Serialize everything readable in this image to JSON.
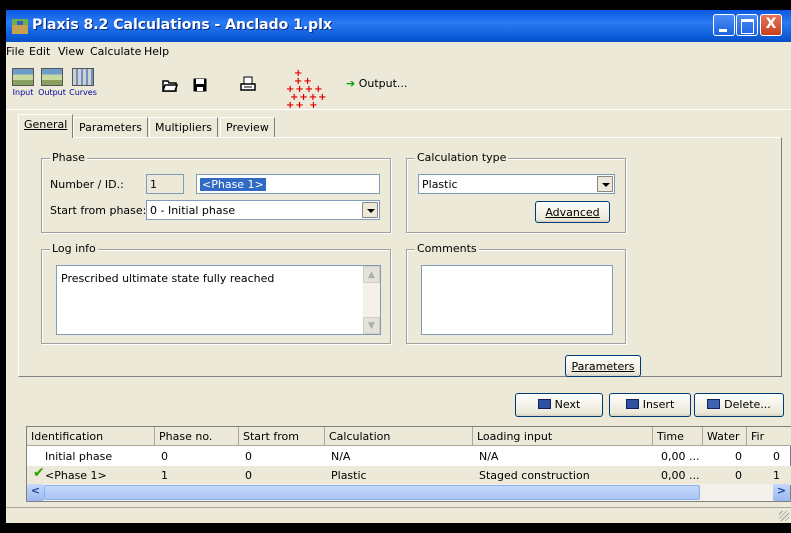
{
  "window": {
    "title": "Plaxis 8.2 Calculations - Anclado 1.plx",
    "controls": [
      "minimize",
      "maximize",
      "close"
    ],
    "close_glyph": "X"
  },
  "menu": {
    "items": [
      "File",
      "Edit",
      "View",
      "Calculate",
      "Help"
    ]
  },
  "toolbar": {
    "input_label": "Input",
    "output_label": "Output",
    "curves_label": "Curves",
    "open_icon": "folder-open-icon",
    "save_icon": "floppy-disk-icon",
    "print_icon": "printer-icon",
    "select_points_icon": "red-plus-grid-icon",
    "output_button_label": "Output..."
  },
  "tabs": [
    {
      "label": "General",
      "active": true
    },
    {
      "label": "Parameters",
      "active": false
    },
    {
      "label": "Multipliers",
      "active": false
    },
    {
      "label": "Preview",
      "active": false
    }
  ],
  "phase": {
    "group_title": "Phase",
    "number_label": "Number / ID.:",
    "number_value": "1",
    "id_value": "<Phase 1>",
    "start_label": "Start from phase:",
    "start_value": "0 - Initial phase"
  },
  "calculation_type": {
    "group_title": "Calculation type",
    "value": "Plastic",
    "advanced_button": "Advanced"
  },
  "log_info": {
    "group_title": "Log info",
    "text": "Prescribed ultimate state fully reached"
  },
  "comments": {
    "group_title": "Comments",
    "text": ""
  },
  "parameters_button": "Parameters",
  "phase_buttons": {
    "next": "Next",
    "insert": "Insert",
    "delete": "Delete..."
  },
  "table": {
    "columns": [
      "Identification",
      "Phase no.",
      "Start from",
      "Calculation",
      "Loading input",
      "Time",
      "Water",
      "Fir"
    ],
    "rows": [
      {
        "identification": "Initial phase",
        "phase_no": "0",
        "start_from": "0",
        "calculation": "N/A",
        "loading_input": "N/A",
        "time": "0,00 ...",
        "water": "0",
        "first": "0",
        "completed": false
      },
      {
        "identification": "<Phase 1>",
        "phase_no": "1",
        "start_from": "0",
        "calculation": "Plastic",
        "loading_input": "Staged construction",
        "time": "0,00 ...",
        "water": "0",
        "first": "1",
        "completed": true
      }
    ],
    "scroll_left_glyph": "<",
    "scroll_right_glyph": ">"
  },
  "colors": {
    "titlebar": "#0a58e0",
    "window_bg": "#ece9d8",
    "selection": "#316ac5",
    "check": "#2aa000"
  }
}
